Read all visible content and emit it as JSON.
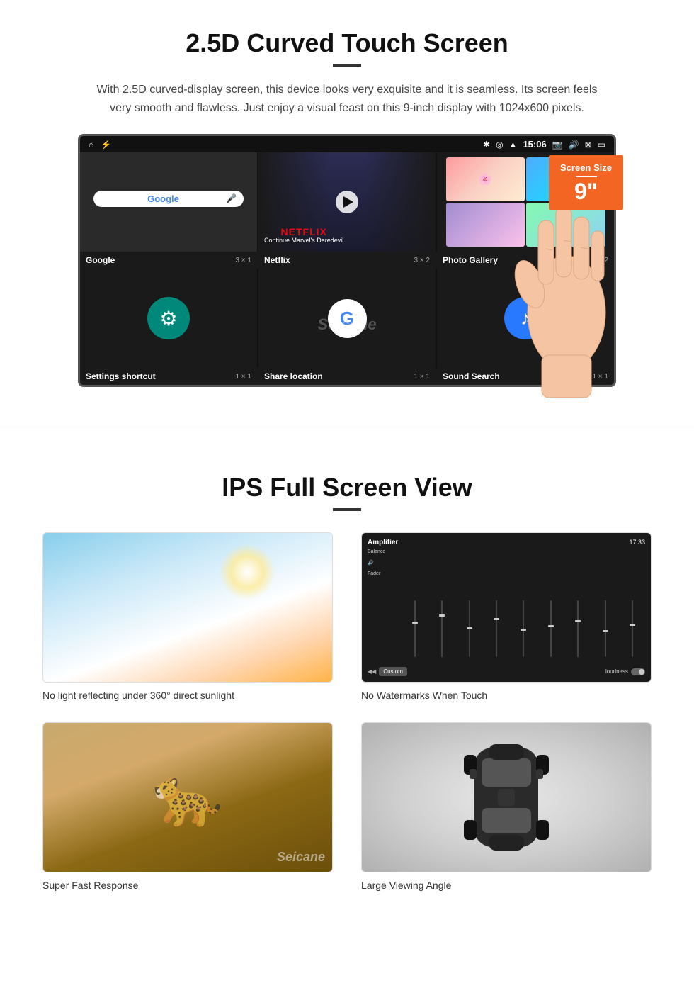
{
  "section1": {
    "title": "2.5D Curved Touch Screen",
    "description": "With 2.5D curved-display screen, this device looks very exquisite and it is seamless. Its screen feels very smooth and flawless. Just enjoy a visual feast on this 9-inch display with 1024x600 pixels.",
    "status_bar": {
      "time": "15:06",
      "icons_right": [
        "bluetooth",
        "location",
        "wifi",
        "camera",
        "volume",
        "x-box",
        "battery"
      ]
    },
    "apps": [
      {
        "name": "Google",
        "size": "3 × 1",
        "type": "google"
      },
      {
        "name": "Netflix",
        "size": "3 × 2",
        "type": "netflix"
      },
      {
        "name": "Photo Gallery",
        "size": "2 × 2",
        "type": "gallery"
      },
      {
        "name": "Settings shortcut",
        "size": "1 × 1",
        "type": "settings"
      },
      {
        "name": "Share location",
        "size": "1 × 1",
        "type": "maps"
      },
      {
        "name": "Sound Search",
        "size": "1 × 1",
        "type": "sound"
      }
    ],
    "netflix_text": "NETFLIX",
    "netflix_subtitle": "Continue Marvel's Daredevil",
    "screen_size_badge": {
      "label": "Screen Size",
      "value": "9\""
    },
    "watermark": "Seicane"
  },
  "section2": {
    "title": "IPS Full Screen View",
    "features": [
      {
        "caption": "No light reflecting under 360° direct sunlight",
        "image_type": "sky"
      },
      {
        "caption": "No Watermarks When Touch",
        "image_type": "amplifier"
      },
      {
        "caption": "Super Fast Response",
        "image_type": "cheetah"
      },
      {
        "caption": "Large Viewing Angle",
        "image_type": "car"
      }
    ],
    "watermark": "Seicane"
  }
}
